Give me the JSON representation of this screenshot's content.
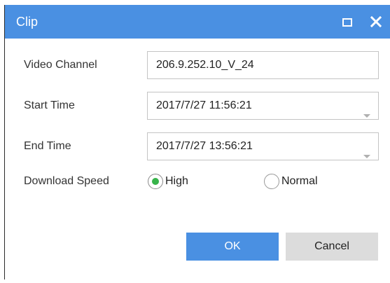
{
  "window": {
    "title": "Clip",
    "accent_color": "#4a90e2",
    "maximize_icon": "maximize-icon",
    "close_icon": "close-icon"
  },
  "form": {
    "video_channel": {
      "label": "Video Channel",
      "value": "206.9.252.10_V_24"
    },
    "start_time": {
      "label": "Start Time",
      "value": "2017/7/27 11:56:21",
      "icon": "chevron-down-icon"
    },
    "end_time": {
      "label": "End Time",
      "value": "2017/7/27 13:56:21",
      "icon": "chevron-down-icon"
    },
    "download_speed": {
      "label": "Download Speed",
      "options": [
        {
          "label": "High",
          "selected": true
        },
        {
          "label": "Normal",
          "selected": false
        }
      ],
      "selected_color": "#37b34a"
    }
  },
  "buttons": {
    "ok_label": "OK",
    "cancel_label": "Cancel"
  }
}
